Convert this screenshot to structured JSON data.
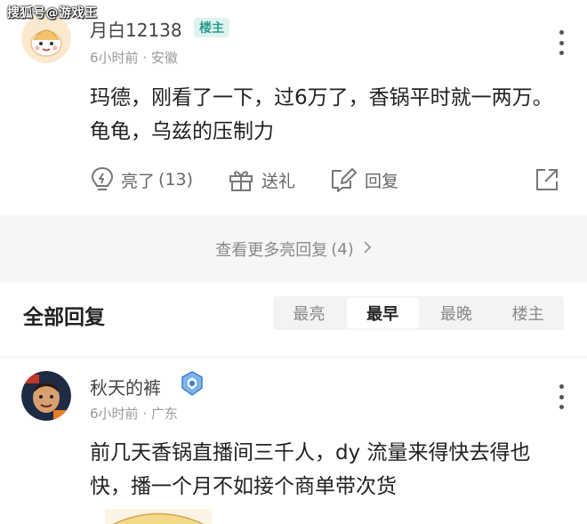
{
  "watermark": "搜狐号@游戏王",
  "comment1": {
    "username": "月白12138",
    "badge": "楼主",
    "time": "6小时前",
    "location": "安徽",
    "meta_sep": "·",
    "text": "玛德，刚看了一下，过6万了，香锅平时就一两万。龟龟，乌兹的压制力",
    "actions": {
      "like_label": "亮了",
      "like_count": "(13)",
      "gift_label": "送礼",
      "reply_label": "回复"
    }
  },
  "more_replies": {
    "label": "查看更多亮回复",
    "count": "(4)"
  },
  "all_replies": {
    "title": "全部回复",
    "sort_tabs": [
      "最亮",
      "最早",
      "最晚",
      "楼主"
    ],
    "active_tab": "最早"
  },
  "comment2": {
    "username": "秋天的裤",
    "time": "6小时前",
    "location": "广东",
    "meta_sep": "·",
    "text": "前几天香锅直播间三千人，dy 流量来得快去得也快，播一个月不如接个商单带次货"
  },
  "colors": {
    "badge_text": "#2a9d8f",
    "badge_bg": "#dff3ef",
    "muted": "#999999",
    "bar_bg": "#f5f6f8"
  },
  "icons": [
    "lightbulb-icon",
    "gift-icon",
    "reply-edit-icon",
    "share-icon",
    "more-vertical-icon",
    "chevron-right-icon"
  ]
}
